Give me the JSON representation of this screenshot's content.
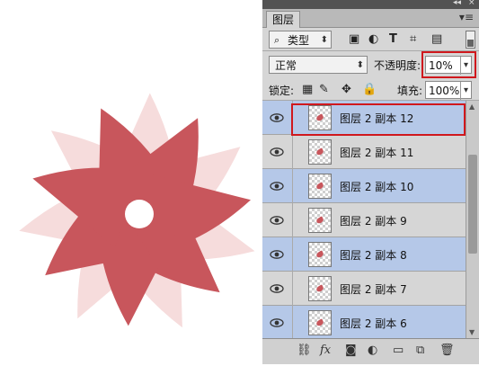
{
  "panel": {
    "tab_label": "图层",
    "filter": {
      "icon": "search-icon",
      "label": "类型"
    },
    "blend_mode": "正常",
    "opacity_label": "不透明度:",
    "opacity_value": "10%",
    "lock_label": "锁定:",
    "fill_label": "填充:",
    "fill_value": "100%",
    "layers": [
      {
        "name": "图层 2 副本 12",
        "selected": true
      },
      {
        "name": "图层 2 副本 11",
        "selected": false
      },
      {
        "name": "图层 2 副本 10",
        "selected": true
      },
      {
        "name": "图层 2 副本 9",
        "selected": false
      },
      {
        "name": "图层 2 副本 8",
        "selected": true
      },
      {
        "name": "图层 2 副本 7",
        "selected": false
      },
      {
        "name": "图层 2 副本 6",
        "selected": true
      }
    ]
  },
  "colors": {
    "flower_main": "#c8565c",
    "flower_ghost": "#f6dcdc",
    "selection_blue": "#b5c8e8",
    "highlight_red": "#d0181d"
  }
}
